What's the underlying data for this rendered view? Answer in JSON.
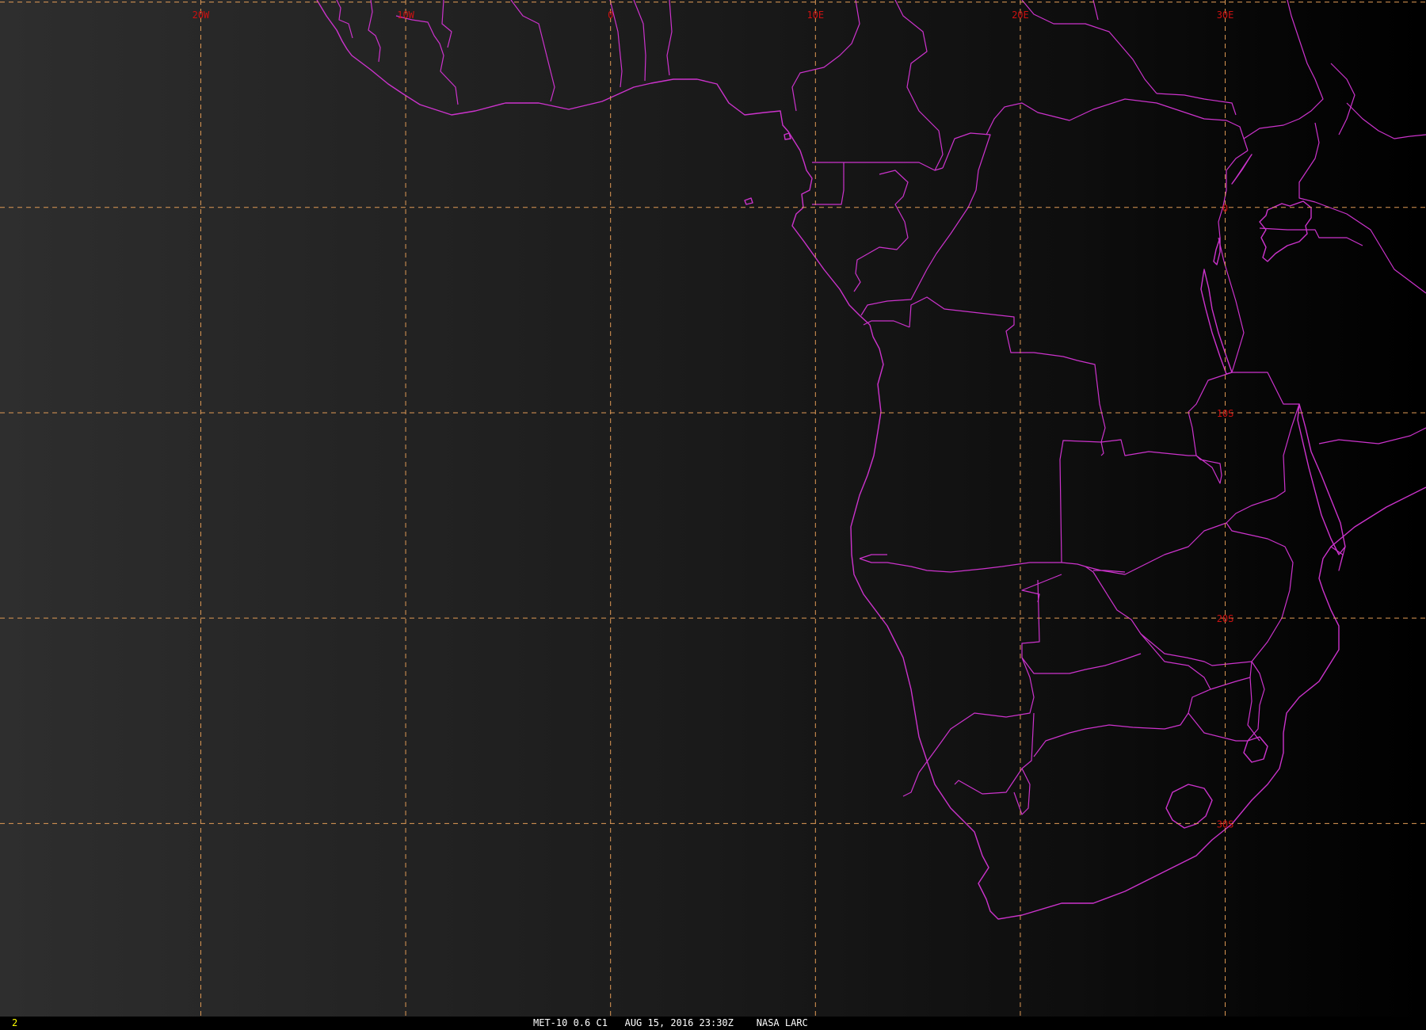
{
  "colors": {
    "background_left": "#2e2e2e",
    "background_right": "#000000",
    "coastline": "#cc33cc",
    "grid": "#e09a55",
    "grid_label": "#cc1111",
    "frame_number": "#ffff00",
    "caption": "#ffffff"
  },
  "map": {
    "projection_extent": {
      "lon_min": -29.8,
      "lon_max": 39.8,
      "lat_min": -39.4,
      "lat_max": 10.1
    },
    "longitude_lines": [
      {
        "lon": -20,
        "label": "20W"
      },
      {
        "lon": -10,
        "label": "10W"
      },
      {
        "lon": 0,
        "label": "0"
      },
      {
        "lon": 10,
        "label": "10E"
      },
      {
        "lon": 20,
        "label": "20E"
      },
      {
        "lon": 30,
        "label": "30E"
      }
    ],
    "latitude_lines": [
      {
        "lat": 10,
        "label": ""
      },
      {
        "lat": 0,
        "label": "0"
      },
      {
        "lat": -10,
        "label": "10S"
      },
      {
        "lat": -20,
        "label": "20S"
      },
      {
        "lat": -30,
        "label": "30S"
      }
    ]
  },
  "status": {
    "frame_number": "2",
    "caption": "MET-10 0.6 C1   AUG 15, 2016 23:30Z    NASA LARC"
  }
}
